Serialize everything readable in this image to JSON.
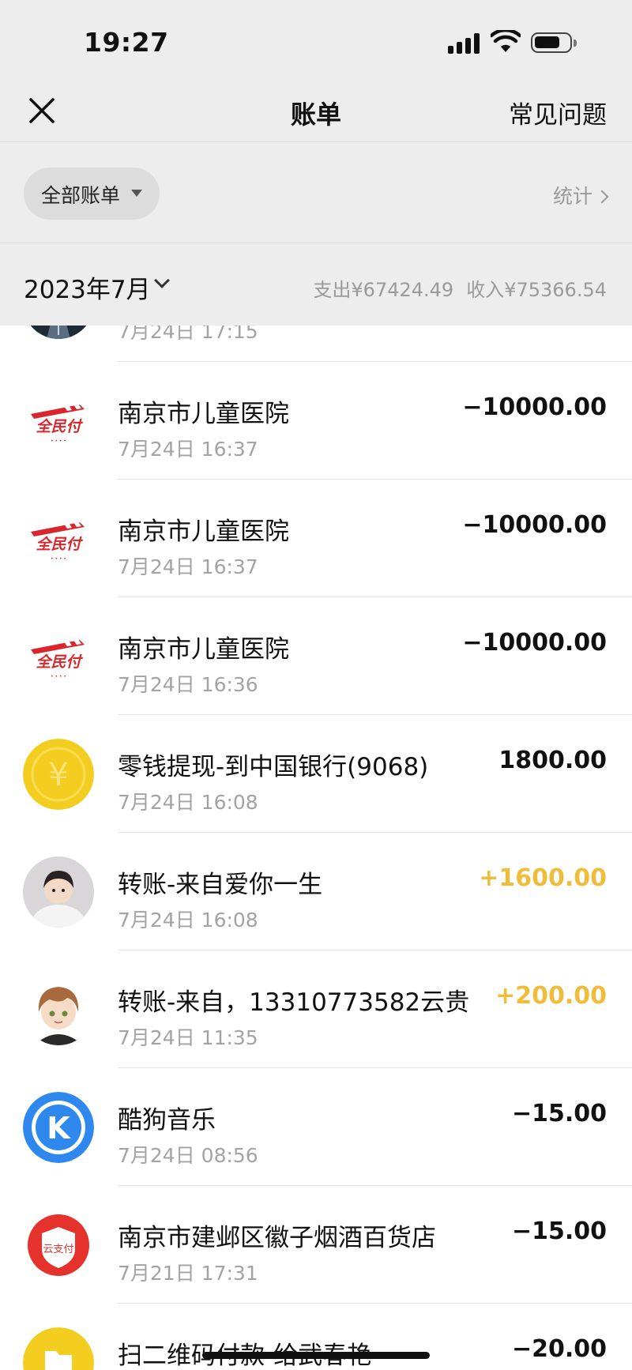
{
  "status_bar": {
    "time": "19:27"
  },
  "nav": {
    "title": "账单",
    "faq": "常见问题"
  },
  "filter": {
    "label": "全部账单",
    "stats": "统计"
  },
  "month": {
    "label": "2023年7月",
    "expense": "支出¥67424.49",
    "income": "收入¥75366.54"
  },
  "transactions": [
    {
      "title": "",
      "date": "7月24日 17:15",
      "amount": "",
      "avatar": "road-photo"
    },
    {
      "title": "南京市儿童医院",
      "date": "7月24日 16:37",
      "amount": "−10000.00",
      "avatar": "quanminfu-logo"
    },
    {
      "title": "南京市儿童医院",
      "date": "7月24日 16:37",
      "amount": "−10000.00",
      "avatar": "quanminfu-logo"
    },
    {
      "title": "南京市儿童医院",
      "date": "7月24日 16:36",
      "amount": "−10000.00",
      "avatar": "quanminfu-logo"
    },
    {
      "title": "零钱提现-到中国银行(9068)",
      "date": "7月24日 16:08",
      "amount": "1800.00",
      "avatar": "yen-coin-icon"
    },
    {
      "title": "转账-来自爱你一生",
      "date": "7月24日 16:08",
      "amount": "+1600.00",
      "avatar": "child-photo"
    },
    {
      "title": "转账-来自，13310773582云贵",
      "date": "7月24日 11:35",
      "amount": "+200.00",
      "avatar": "anime-avatar"
    },
    {
      "title": "酷狗音乐",
      "date": "7月24日 08:56",
      "amount": "−15.00",
      "avatar": "kugou-logo"
    },
    {
      "title": "南京市建邺区徽子烟酒百货店",
      "date": "7月21日 17:31",
      "amount": "−15.00",
      "avatar": "yunzhifu-logo"
    },
    {
      "title": "扫二维码付款-给武春艳",
      "date": "",
      "amount": "−20.00",
      "avatar": "folder-icon"
    }
  ],
  "colors": {
    "income": "#f0bd3a",
    "coin": "#f3cd1f",
    "kugou": "#2e88ee",
    "pay_red": "#d9262c"
  }
}
